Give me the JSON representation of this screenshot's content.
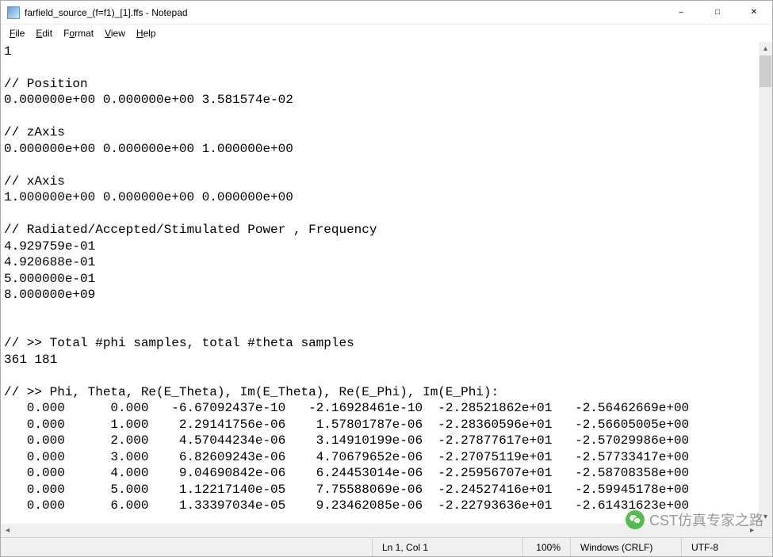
{
  "window": {
    "title": "farfield_source_(f=f1)_[1].ffs - Notepad"
  },
  "menu": {
    "file": "File",
    "edit": "Edit",
    "format": "Format",
    "view": "View",
    "help": "Help"
  },
  "content": "1\n\n// Position\n0.000000e+00 0.000000e+00 3.581574e-02\n\n// zAxis\n0.000000e+00 0.000000e+00 1.000000e+00\n\n// xAxis\n1.000000e+00 0.000000e+00 0.000000e+00\n\n// Radiated/Accepted/Stimulated Power , Frequency\n4.929759e-01\n4.920688e-01\n5.000000e-01\n8.000000e+09\n\n\n// >> Total #phi samples, total #theta samples\n361 181\n\n// >> Phi, Theta, Re(E_Theta), Im(E_Theta), Re(E_Phi), Im(E_Phi):\n   0.000      0.000   -6.67092437e-10   -2.16928461e-10  -2.28521862e+01   -2.56462669e+00\n   0.000      1.000    2.29141756e-06    1.57801787e-06  -2.28360596e+01   -2.56605005e+00\n   0.000      2.000    4.57044234e-06    3.14910199e-06  -2.27877617e+01   -2.57029986e+00\n   0.000      3.000    6.82609243e-06    4.70679652e-06  -2.27075119e+01   -2.57733417e+00\n   0.000      4.000    9.04690842e-06    6.24453014e-06  -2.25956707e+01   -2.58708358e+00\n   0.000      5.000    1.12217140e-05    7.75588069e-06  -2.24527416e+01   -2.59945178e+00\n   0.000      6.000    1.33397034e-05    9.23462085e-06  -2.22793636e+01   -2.61431623e+00",
  "status": {
    "position": "Ln 1, Col 1",
    "zoom": "100%",
    "line_ending": "Windows (CRLF)",
    "encoding": "UTF-8"
  },
  "watermark": {
    "text": "CST仿真专家之路"
  }
}
